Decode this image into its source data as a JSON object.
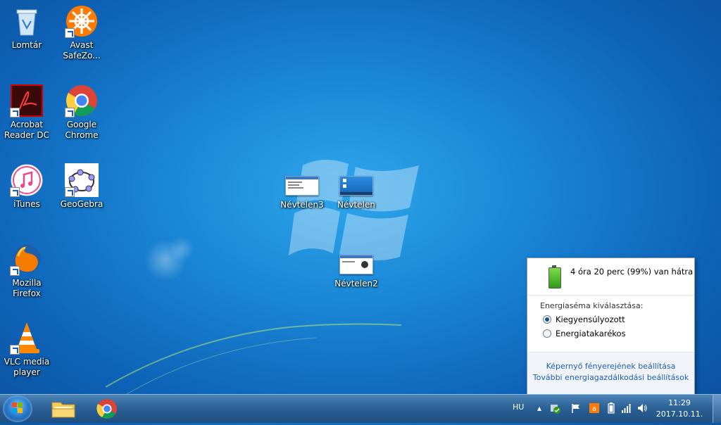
{
  "desktop": {
    "icons": [
      {
        "label1": "Lomtár",
        "label2": ""
      },
      {
        "label1": "Avast",
        "label2": "SafeZo..."
      },
      {
        "label1": "Acrobat",
        "label2": "Reader DC"
      },
      {
        "label1": "Google",
        "label2": "Chrome"
      },
      {
        "label1": "iTunes",
        "label2": ""
      },
      {
        "label1": "GeoGebra",
        "label2": ""
      },
      {
        "label1": "Mozilla",
        "label2": "Firefox"
      },
      {
        "label1": "VLC media",
        "label2": "player"
      }
    ],
    "thumbs": [
      {
        "label": "Névtelen3"
      },
      {
        "label": "Névtelen"
      },
      {
        "label": "Névtelen2"
      }
    ]
  },
  "power_popup": {
    "status": "4 óra 20 perc (99%) van hátra",
    "plan_heading": "Energiaséma kiválasztása:",
    "plans": [
      {
        "label": "Kiegyensúlyozott",
        "selected": true
      },
      {
        "label": "Energiatakarékos",
        "selected": false
      }
    ],
    "link1": "Képernyő fényerejének beállítása",
    "link2": "További energiagazdálkodási beállítások"
  },
  "taskbar": {
    "language": "HU",
    "time": "11:29",
    "date": "2017.10.11."
  },
  "colors": {
    "accent": "#1c5bb4",
    "battery_green": "#2e9a1b"
  }
}
